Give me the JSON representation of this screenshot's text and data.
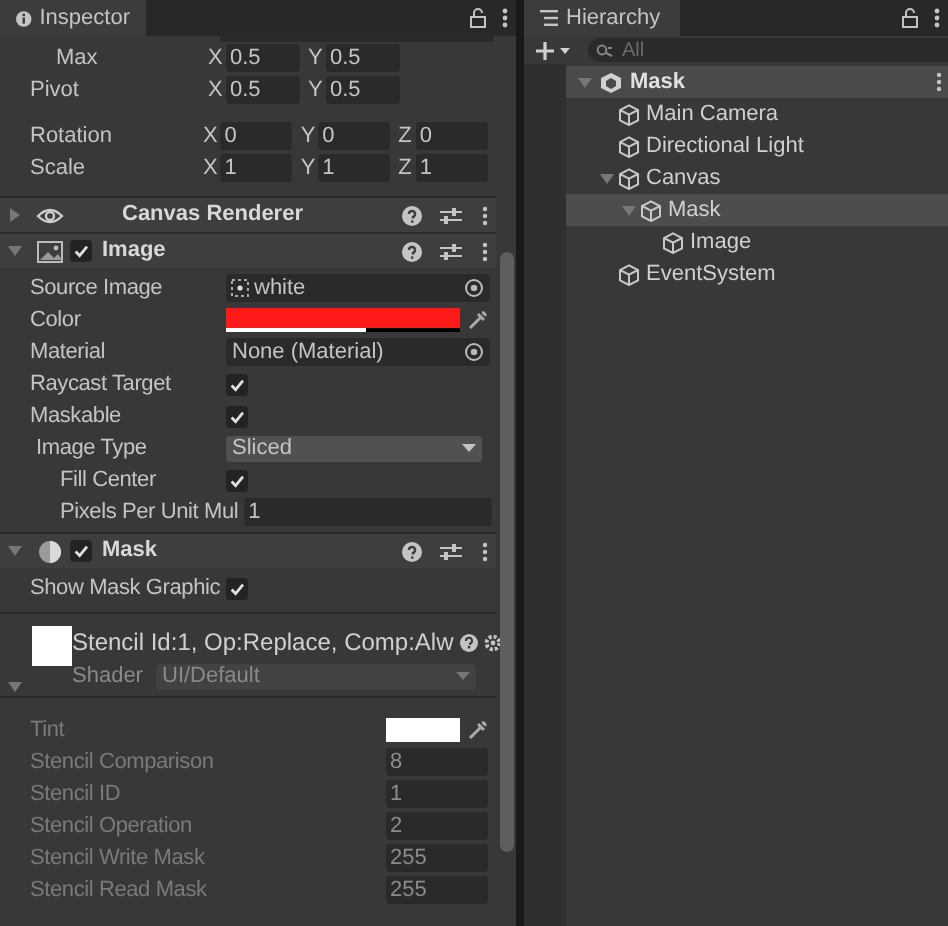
{
  "inspector": {
    "title": "Inspector",
    "transform_rows": [
      {
        "label": "Max",
        "sub": true,
        "fields": [
          {
            "axis": "X",
            "value": "0.5"
          },
          {
            "axis": "Y",
            "value": "0.5"
          }
        ]
      },
      {
        "label": "Pivot",
        "fields": [
          {
            "axis": "X",
            "value": "0.5"
          },
          {
            "axis": "Y",
            "value": "0.5"
          }
        ]
      },
      {
        "label": "Rotation",
        "fields": [
          {
            "axis": "X",
            "value": "0"
          },
          {
            "axis": "Y",
            "value": "0"
          },
          {
            "axis": "Z",
            "value": "0"
          }
        ]
      },
      {
        "label": "Scale",
        "fields": [
          {
            "axis": "X",
            "value": "1"
          },
          {
            "axis": "Y",
            "value": "1"
          },
          {
            "axis": "Z",
            "value": "1"
          }
        ]
      }
    ],
    "components": [
      {
        "name": "Canvas Renderer",
        "expanded": false
      },
      {
        "name": "Image",
        "expanded": true,
        "enabled": true,
        "properties": [
          {
            "kind": "object",
            "label": "Source Image",
            "value": "white"
          },
          {
            "kind": "color",
            "label": "Color",
            "color": "#ff1a1a",
            "level": 0.6
          },
          {
            "kind": "object",
            "label": "Material",
            "value": "None (Material)"
          },
          {
            "kind": "checkbox",
            "label": "Raycast Target",
            "checked": true
          },
          {
            "kind": "checkbox",
            "label": "Maskable",
            "checked": true
          },
          {
            "kind": "dropdown",
            "label": "Image Type",
            "value": "Sliced",
            "children": [
              {
                "kind": "checkbox",
                "label": "Fill Center",
                "checked": true
              },
              {
                "kind": "text",
                "label": "Pixels Per Unit Mul",
                "value": "1"
              }
            ]
          }
        ]
      },
      {
        "name": "Mask",
        "expanded": true,
        "enabled": true,
        "properties": [
          {
            "kind": "checkbox",
            "label": "Show Mask Graphic",
            "checked": true
          }
        ]
      }
    ],
    "material": {
      "title": "Stencil Id:1, Op:Replace, Comp:Alw",
      "shader_label": "Shader",
      "shader": "UI/Default",
      "expanded": true,
      "properties": [
        {
          "kind": "color",
          "label": "Tint",
          "color": "#ffffff"
        },
        {
          "kind": "text",
          "label": "Stencil Comparison",
          "value": "8"
        },
        {
          "kind": "text",
          "label": "Stencil ID",
          "value": "1"
        },
        {
          "kind": "text",
          "label": "Stencil Operation",
          "value": "2"
        },
        {
          "kind": "text",
          "label": "Stencil Write Mask",
          "value": "255"
        },
        {
          "kind": "text",
          "label": "Stencil Read Mask",
          "value": "255"
        }
      ]
    }
  },
  "hierarchy": {
    "title": "Hierarchy",
    "search_placeholder": "All",
    "scene": {
      "label": "Mask",
      "expanded": true,
      "children": [
        {
          "label": "Main Camera",
          "selected": false
        },
        {
          "label": "Directional Light",
          "selected": false
        },
        {
          "label": "Canvas",
          "selected": false,
          "expanded": true,
          "children": [
            {
              "label": "Mask",
              "selected": true,
              "expanded": true,
              "children": [
                {
                  "label": "Image",
                  "selected": false
                }
              ]
            }
          ]
        },
        {
          "label": "EventSystem",
          "selected": false
        }
      ]
    }
  }
}
